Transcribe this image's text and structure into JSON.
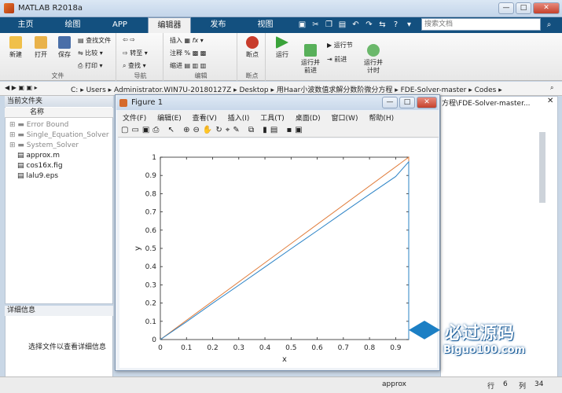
{
  "window": {
    "title": "MATLAB R2018a",
    "min": "—",
    "max": "□",
    "close": "✕"
  },
  "tabs": [
    {
      "label": "主页",
      "active": false
    },
    {
      "label": "绘图",
      "active": false
    },
    {
      "label": "APP",
      "active": false
    },
    {
      "label": "编辑器",
      "active": true
    },
    {
      "label": "发布",
      "active": false
    },
    {
      "label": "视图",
      "active": false
    }
  ],
  "search": {
    "placeholder": "搜索文档"
  },
  "ribbon": {
    "file": {
      "group": "文件",
      "new": "新建",
      "open": "打开",
      "save": "保存",
      "find_files": "查找文件",
      "compare": "比较",
      "print": "打印"
    },
    "nav": {
      "group": "导航",
      "goto": "转至",
      "find": "查找"
    },
    "edit": {
      "group": "编辑",
      "insert": "插入",
      "comment": "注释",
      "indent": "缩进",
      "fx": "fx"
    },
    "breakpoints": {
      "group": "断点",
      "breakpoints": "断点"
    },
    "run": {
      "run": "运行",
      "run_advance": "运行并\n前进",
      "run_section": "运行节",
      "advance": "前进",
      "run_time": "运行并\n计时"
    }
  },
  "address": {
    "segments": [
      "C:",
      "Users",
      "Administrator.WIN7U-20180127Z",
      "Desktop",
      "用Haar小波数值求解分数阶微分方程",
      "FDE-Solver-master",
      "Codes"
    ]
  },
  "current_folder": {
    "title": "当前文件夹",
    "column": "名称",
    "folders": [
      "Error Bound",
      "Single_Equation_Solver",
      "System_Solver"
    ],
    "files": [
      "approx.m",
      "cos16x.fig",
      "lalu9.eps"
    ]
  },
  "details": {
    "title": "详细信息",
    "message": "选择文件以查看详细信息"
  },
  "right_panel": {
    "path": "方程\\FDE-Solver-master..."
  },
  "status": {
    "script": "approx",
    "row_label": "行",
    "row": "6",
    "col_label": "列",
    "col": "34"
  },
  "figure": {
    "title": "Figure 1",
    "menu": [
      "文件(F)",
      "编辑(E)",
      "查看(V)",
      "插入(I)",
      "工具(T)",
      "桌面(D)",
      "窗口(W)",
      "帮助(H)"
    ]
  },
  "watermark": {
    "main": "必过源码",
    "sub": "Biguo100.com"
  },
  "chart_data": {
    "type": "line",
    "xlabel": "x",
    "ylabel": "y",
    "xlim": [
      0,
      0.95
    ],
    "ylim": [
      0,
      1
    ],
    "xticks": [
      "0",
      "0.1",
      "0.2",
      "0.3",
      "0.4",
      "0.5",
      "0.6",
      "0.7",
      "0.8",
      "0.9"
    ],
    "yticks": [
      "0",
      "0.1",
      "0.2",
      "0.3",
      "0.4",
      "0.5",
      "0.6",
      "0.7",
      "0.8",
      "0.9",
      "1"
    ],
    "grid": false,
    "series": [
      {
        "color": "#e07b39",
        "points": [
          [
            0,
            0
          ],
          [
            0.95,
            1.0
          ],
          [
            0.95,
            0.0
          ]
        ]
      },
      {
        "color": "#2b83c6",
        "points": [
          [
            0,
            0
          ],
          [
            0.1,
            0.098
          ],
          [
            0.2,
            0.199
          ],
          [
            0.3,
            0.298
          ],
          [
            0.4,
            0.398
          ],
          [
            0.5,
            0.498
          ],
          [
            0.6,
            0.597
          ],
          [
            0.7,
            0.697
          ],
          [
            0.8,
            0.796
          ],
          [
            0.9,
            0.894
          ],
          [
            0.95,
            0.975
          ],
          [
            0.95,
            0.0
          ]
        ]
      }
    ]
  }
}
